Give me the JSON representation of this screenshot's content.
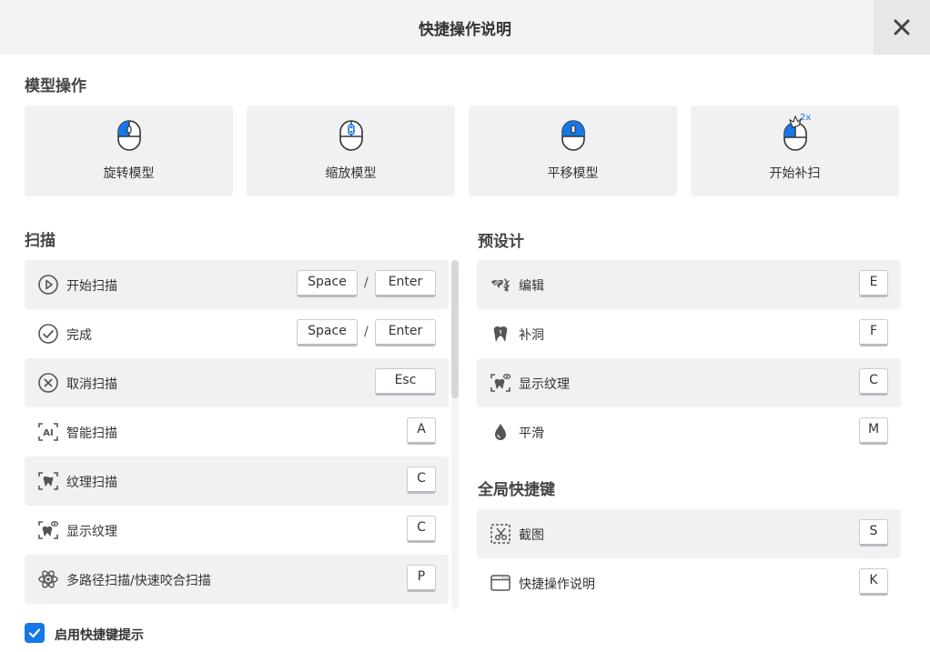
{
  "dialog": {
    "title": "快捷操作说明"
  },
  "model_ops": {
    "heading": "模型操作",
    "cards": [
      {
        "label": "旋转模型",
        "icon": "mouse-left-click-icon"
      },
      {
        "label": "缩放模型",
        "icon": "mouse-scroll-icon"
      },
      {
        "label": "平移模型",
        "icon": "mouse-middle-click-icon"
      },
      {
        "label": "开始补扫",
        "icon": "mouse-double-click-icon",
        "badge": "2x"
      }
    ]
  },
  "scan": {
    "heading": "扫描",
    "rows": [
      {
        "label": "开始扫描",
        "icon": "play-circle-icon",
        "keys": [
          "Space",
          "Enter"
        ],
        "separator": "/"
      },
      {
        "label": "完成",
        "icon": "check-circle-icon",
        "keys": [
          "Space",
          "Enter"
        ],
        "separator": "/"
      },
      {
        "label": "取消扫描",
        "icon": "cancel-circle-icon",
        "keys": [
          "Esc"
        ]
      },
      {
        "label": "智能扫描",
        "icon": "ai-scan-icon",
        "keys": [
          "A"
        ]
      },
      {
        "label": "纹理扫描",
        "icon": "texture-scan-icon",
        "keys": [
          "C"
        ]
      },
      {
        "label": "显示纹理",
        "icon": "show-texture-icon",
        "keys": [
          "C"
        ]
      },
      {
        "label": "多路径扫描/快速咬合扫描",
        "icon": "multipath-scan-icon",
        "keys": [
          "P"
        ]
      }
    ]
  },
  "predesign": {
    "heading": "预设计",
    "rows": [
      {
        "label": "编辑",
        "icon": "edit-icon",
        "keys": [
          "E"
        ]
      },
      {
        "label": "补洞",
        "icon": "tooth-fill-icon",
        "keys": [
          "F"
        ]
      },
      {
        "label": "显示纹理",
        "icon": "show-texture-icon",
        "keys": [
          "C"
        ]
      },
      {
        "label": "平滑",
        "icon": "smooth-drop-icon",
        "keys": [
          "M"
        ]
      }
    ]
  },
  "global": {
    "heading": "全局快捷键",
    "rows": [
      {
        "label": "截图",
        "icon": "screenshot-icon",
        "keys": [
          "S"
        ]
      },
      {
        "label": "快捷操作说明",
        "icon": "window-icon",
        "keys": [
          "K"
        ]
      }
    ]
  },
  "footer": {
    "checkbox_label": "启用快捷键提示",
    "checked": true
  },
  "colors": {
    "accent": "#1677e6",
    "row_bg": "#f0f1f3",
    "header_bg": "#f2f3f4"
  }
}
